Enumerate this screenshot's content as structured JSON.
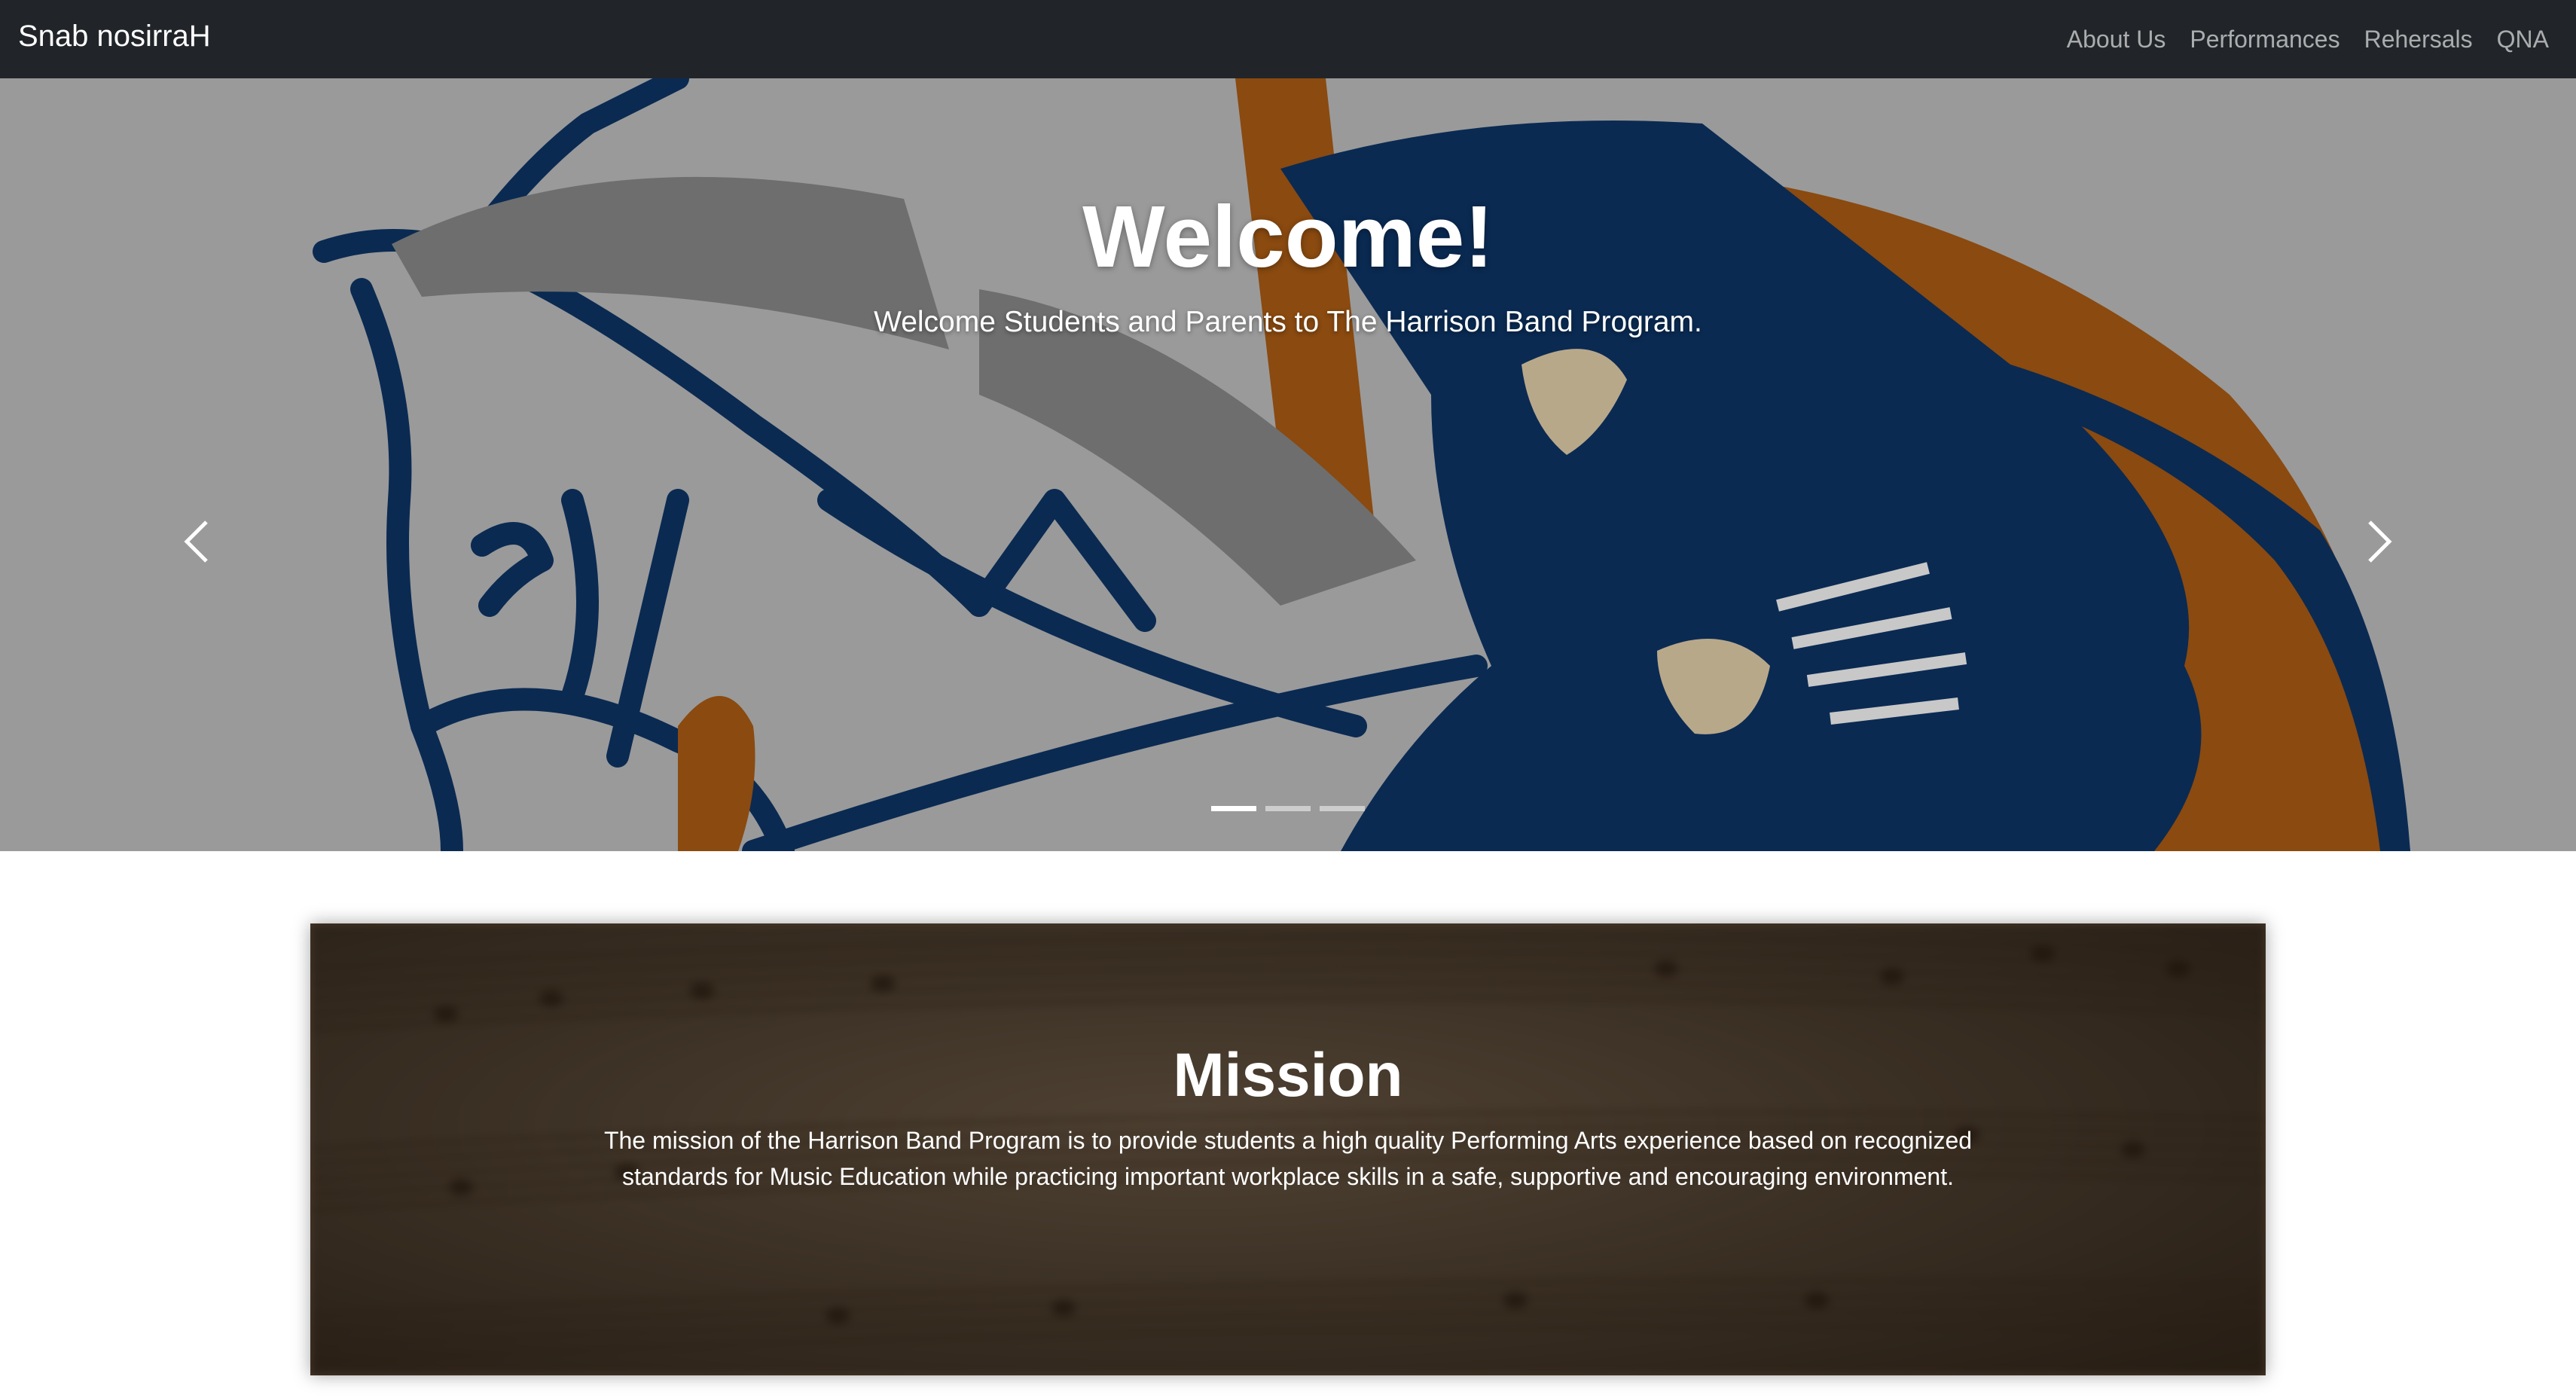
{
  "navbar": {
    "brand": "Snab nosirraH",
    "links": [
      "About Us",
      "Performances",
      "Rehersals",
      "QNA"
    ]
  },
  "hero": {
    "title": "Welcome!",
    "subtitle": "Welcome Students and Parents to The Harrison Band Program.",
    "controls": {
      "prev_icon": "chevron-left-icon",
      "next_icon": "chevron-right-icon"
    },
    "slide_count": 3,
    "active_slide": 1
  },
  "mission": {
    "title": "Mission",
    "text": "The mission of the Harrison Band Program is to provide students a high quality Performing Arts experience based on recognized standards for Music Education while practicing important workplace skills in a safe, supportive and encouraging environment."
  },
  "colors": {
    "navbar_bg": "#212529",
    "logo_navy": "#0a2a52",
    "logo_orange": "#8a4a10",
    "hero_gray": "#9a9a9a"
  }
}
